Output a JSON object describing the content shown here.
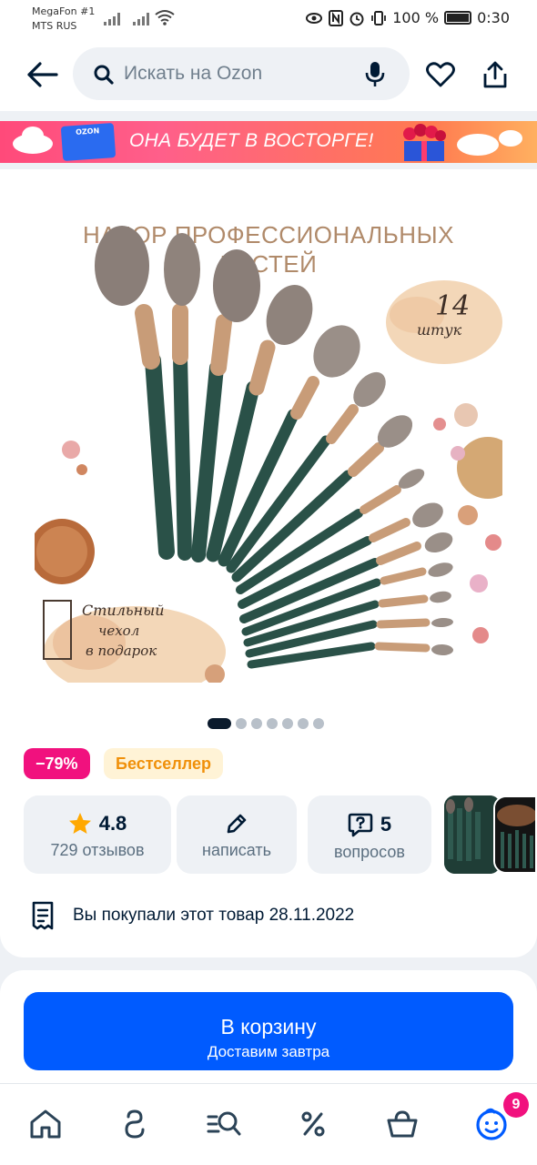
{
  "status_bar": {
    "carrier_primary": "MegaFon #1",
    "carrier_secondary": "MTS RUS",
    "battery": "100 %",
    "time": "0:30"
  },
  "header": {
    "search_placeholder": "Искать на Ozon",
    "icons": [
      "arrow-left-icon",
      "search-icon",
      "microphone-icon",
      "heart-icon",
      "share-icon"
    ]
  },
  "promo_banner": {
    "text": "ОНА БУДЕТ В ВОСТОРГЕ!",
    "logo_text": "OZON"
  },
  "product_image": {
    "title_line1": "НАБОР ПРОФЕССИОНАЛЬНЫХ",
    "title_line2": "КИСТЕЙ",
    "count_label": "14 штук",
    "gift_label": "Стильный чехол в подарок",
    "carousel_total": 7,
    "carousel_active": 1
  },
  "badges": {
    "discount": "−79%",
    "bestseller": "Бестселлер"
  },
  "stats": {
    "rating_value": "4.8",
    "reviews_label": "729 отзывов",
    "write_label": "написать",
    "questions_count": "5",
    "questions_label": "вопросов"
  },
  "purchase_info": {
    "text": "Вы покупали этот товар 28.11.2022"
  },
  "cart": {
    "button_title": "В корзину",
    "button_subtitle": "Доставим завтра"
  },
  "bottom_nav": {
    "items": [
      "home-icon",
      "fresh-icon",
      "catalog-icon",
      "discounts-icon",
      "cart-icon",
      "profile-icon"
    ],
    "profile_badge": "9"
  },
  "colors": {
    "accent": "#005bff",
    "discount": "#f1117e",
    "bestseller_text": "#f0900a",
    "star": "#ffa800"
  }
}
